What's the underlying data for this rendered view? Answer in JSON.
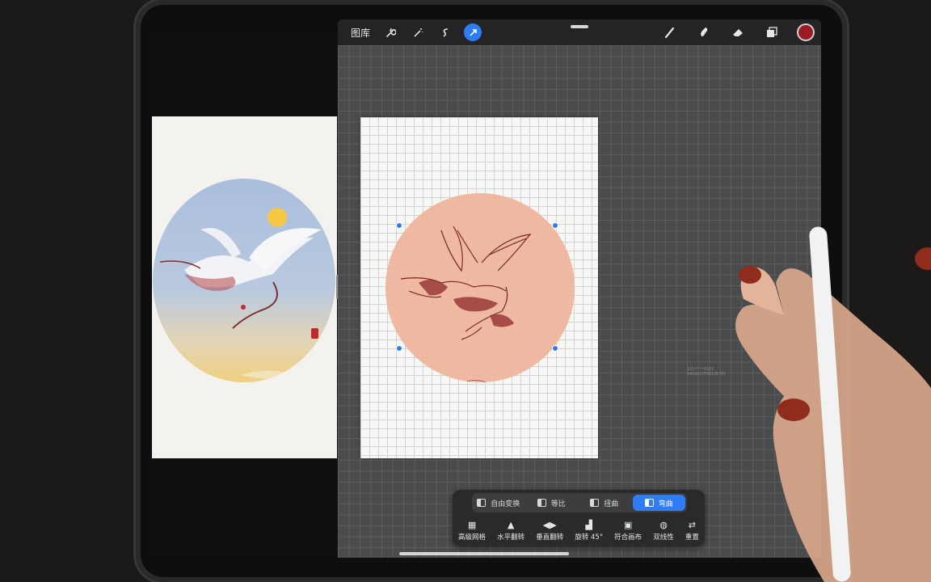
{
  "toolbar": {
    "gallery_label": "图库",
    "left_icons": [
      "wrench-icon",
      "magic-wand-icon",
      "selection-icon",
      "transform-arrow-icon"
    ],
    "right_icons": [
      "brush-icon",
      "smudge-icon",
      "eraser-icon",
      "layers-icon"
    ],
    "current_color": "#9b1b22",
    "accent": "#2f7df6"
  },
  "transform": {
    "modes": [
      {
        "label": "自由变换",
        "active": false
      },
      {
        "label": "等比",
        "active": false
      },
      {
        "label": "扭曲",
        "active": false
      },
      {
        "label": "弯曲",
        "active": true
      }
    ],
    "tools": [
      {
        "label": "高级网格",
        "icon": "grid-icon"
      },
      {
        "label": "水平翻转",
        "icon": "flip-horizontal-icon"
      },
      {
        "label": "垂直翻转",
        "icon": "flip-vertical-icon"
      },
      {
        "label": "旋转 45°",
        "icon": "rotate-icon"
      },
      {
        "label": "符合画布",
        "icon": "fit-canvas-icon"
      },
      {
        "label": "双线性",
        "icon": "interpolation-icon"
      },
      {
        "label": "重置",
        "icon": "reset-icon"
      }
    ]
  },
  "canvas_hint": {
    "line1": "115****0127",
    "line2": "6469897P0917E707"
  }
}
